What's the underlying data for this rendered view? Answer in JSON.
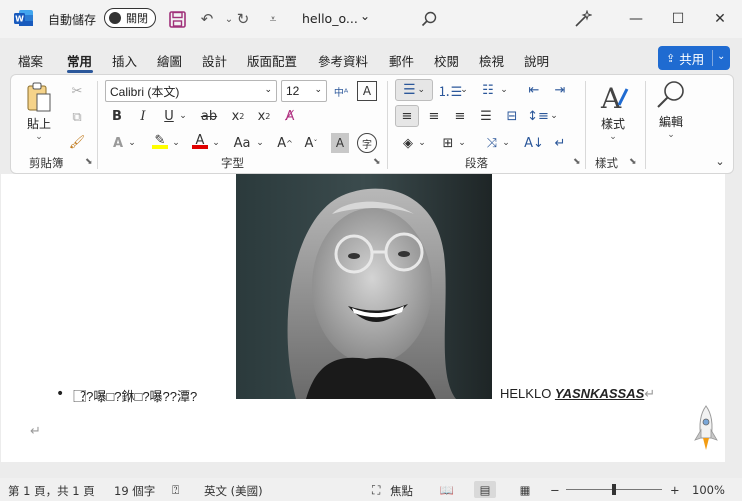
{
  "titlebar": {
    "autosave_label": "自動儲存",
    "toggle_label": "關閉",
    "doc_title": "hello_o...",
    "doc_chevron": "⌄"
  },
  "tabs": [
    "檔案",
    "常用",
    "插入",
    "繪圖",
    "設計",
    "版面配置",
    "參考資料",
    "郵件",
    "校閱",
    "檢視",
    "說明"
  ],
  "active_tab": "常用",
  "share_label": "共用",
  "ribbon": {
    "clipboard": {
      "paste_label": "貼上",
      "group_label": "剪貼簿"
    },
    "font": {
      "font_name": "Calibri (本文)",
      "font_size": "12",
      "group_label": "字型"
    },
    "paragraph": {
      "group_label": "段落"
    },
    "styles": {
      "label": "樣式",
      "group_label": "樣式"
    },
    "editing": {
      "label": "編輯"
    }
  },
  "document": {
    "line_left": "?⃞?嚗□?銝□?嚗??潭?",
    "line_right_plain": "HELKLO ",
    "line_right_bold": "YASNKASSAS",
    "para_mark": "↵"
  },
  "statusbar": {
    "page": "第 1 頁，共 1 頁",
    "words": "19 個字",
    "language": "英文 (美國)",
    "focus": "焦點",
    "zoom": "100%",
    "minus": "−",
    "plus": "+"
  },
  "colors": {
    "accent": "#2b579a",
    "share_bg": "#1f6bd1",
    "highlight": "#ffff00",
    "font_color": "#e00000"
  }
}
